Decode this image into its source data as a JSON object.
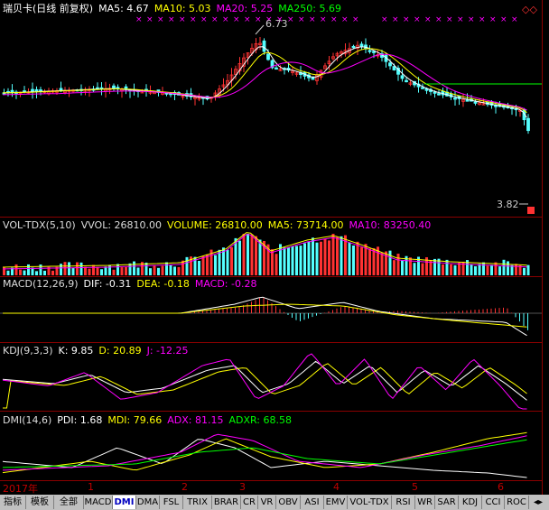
{
  "price_pane": {
    "title": "瑞贝卡(日线 前复权)",
    "ma5": "MA5: 4.67",
    "ma10": "MA10: 5.03",
    "ma20": "MA20: 5.25",
    "ma250": "MA250: 5.69",
    "high_label": "6.73",
    "low_label": "3.82",
    "colors": {
      "ma5": "#ffffff",
      "ma10": "#ffff00",
      "ma20": "#ff00ff",
      "ma250": "#00ff00",
      "up": "#ff3232",
      "down": "#54ffff"
    }
  },
  "vol_pane": {
    "title": "VOL-TDX(5,10)",
    "vvol": "VVOL: 26810.00",
    "volume": "VOLUME: 26810.00",
    "ma5": "MA5: 73714.00",
    "ma10": "MA10: 83250.40"
  },
  "macd_pane": {
    "title": "MACD(12,26,9)",
    "dif": "DIF: -0.31",
    "dea": "DEA: -0.18",
    "macd": "MACD: -0.28"
  },
  "kdj_pane": {
    "title": "KDJ(9,3,3)",
    "k": "K: 9.85",
    "d": "D: 20.89",
    "j": "J: -12.25"
  },
  "dmi_pane": {
    "title": "DMI(14,6)",
    "pdi": "PDI: 1.68",
    "mdi": "MDI: 79.66",
    "adx": "ADX: 81.15",
    "adxr": "ADXR: 68.58"
  },
  "date_axis": {
    "year_label": "2017年",
    "months": [
      "1",
      "2",
      "3",
      "4",
      "5",
      "6"
    ]
  },
  "tabs": [
    "指标",
    "模板",
    "全部",
    "MACD",
    "DMI",
    "DMA",
    "FSL",
    "TRIX",
    "BRAR",
    "CR",
    "VR",
    "OBV",
    "ASI",
    "EMV",
    "VOL-TDX",
    "RSI",
    "WR",
    "SAR",
    "KDJ",
    "CCI",
    "ROC"
  ],
  "active_tab": "DMI"
}
